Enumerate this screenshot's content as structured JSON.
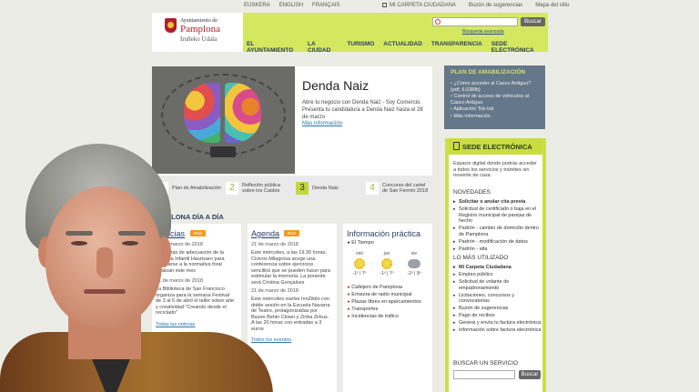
{
  "topbar": {
    "languages": [
      "EUSKERA",
      "ENGLISH",
      "FRANÇAIS"
    ],
    "links": [
      "MI CARPETA CIUDADANA",
      "Buzón de sugerencias",
      "Mapa del sitio"
    ]
  },
  "header": {
    "logo": {
      "line1": "Ayuntamiento de",
      "line2": "Pamplona",
      "line3": "Iruñeko Udala"
    },
    "search_placeholder": "",
    "search_button": "Buscar",
    "advanced_search": "Búsqueda avanzada",
    "nav": [
      "EL AYUNTAMIENTO",
      "LA CIUDAD",
      "TURISMO",
      "ACTUALIDAD",
      "TRANSPARENCIA",
      "SEDE ELECTRÓNICA"
    ]
  },
  "hero": {
    "title": "Denda Naiz",
    "text": "Abre tu negocio con Denda Naiz - Soy Comercio. Presenta tu candidatura a Denda Naiz hasta el 28 de marzo",
    "more": "Más información",
    "tabs": [
      {
        "num": "1",
        "label": "Plan de Amabilización"
      },
      {
        "num": "2",
        "label": "Reflexión pública sobre los Caídos"
      },
      {
        "num": "3",
        "label": "Denda Naiz"
      },
      {
        "num": "4",
        "label": "Concurso del cartel de San Fermín 2018"
      }
    ]
  },
  "amabilizacion": {
    "title": "PLAN DE AMABILIZACIÓN",
    "items": [
      "¿Cómo acceder al Casco Antiguo? (pdf, 6,63Mb)",
      "Control de acceso de vehículos al Casco Antiguo",
      "Aplicación Tok-tok",
      "Más información"
    ]
  },
  "sede": {
    "title": "SEDE ELECTRÓNICA",
    "description": "Espacio digital donde podrás acceder a todos los servicios y trámites sin moverte de casa",
    "novedades_title": "NOVEDADES",
    "novedades": [
      "Solicitar o anular cita previa",
      "Solicitud de certificado o baja en el Registro municipal de parejas de hecho",
      "Padrón - cambio de domicilio dentro de Pamplona",
      "Padrón - modificación de datos",
      "Padrón - alta"
    ],
    "mas_title": "LO MÁS UTILIZADO",
    "mas": [
      "Mi Carpeta Ciudadana",
      "Empleo público",
      "Solicitud de volante de empadronamiento",
      "Licitaciones, concursos y convocatorias",
      "Buzón de sugerencias",
      "Pago de recibos",
      "Genera y envía tu factura electrónica",
      "Información sobre factura electrónica"
    ],
    "buscar_title": "BUSCAR UN SERVICIO",
    "buscar_button": "Buscar"
  },
  "dia": {
    "title": "PAMPLONA DÍA A DÍA",
    "noticias": {
      "title": "Noticias",
      "rss": "RSS",
      "items": [
        {
          "date": "21 de marzo de 2018",
          "text": "Las obras de adecuación de la Escuela Infantil Haurtzaro para adaptarse a la normativa foral finalizan este mes"
        },
        {
          "date": "21 de marzo de 2018",
          "text": "La Biblioteca de San Francisco organiza para la semana Festival de 3 al 6 de abril el taller sobre arte y creatividad \"Creando desde el reciclado\""
        }
      ],
      "all": "Todas las noticias"
    },
    "agenda": {
      "title": "Agenda",
      "rss": "RSS",
      "items": [
        {
          "date": "21 de marzo de 2018",
          "text": "Este miércoles, a las 19.30 horas, Civivox Milagrosa acoge una conferencia sobre ejercicios sencillos que se pueden hacer para estimular la memoria. La ponente será Cristina Gonçalves"
        },
        {
          "date": "21 de marzo de 2018",
          "text": "Este miércoles vuelve InnZikilo con doble sesión en la Escuela Navarra de Teatro, protagonizadas por Bazen Behin Clown y Zirika Zirkus. A las 20 horas con entradas a 3 euros"
        }
      ],
      "all": "Todos los eventos"
    },
    "info": {
      "title": "Información práctica",
      "tiempo": "El Tiempo",
      "weather": [
        {
          "day": "mié",
          "temps": "-1º | 7º",
          "icon": "sun-icon"
        },
        {
          "day": "jue",
          "temps": "-1º | 7º",
          "icon": "sun-icon"
        },
        {
          "day": "vie",
          "temps": "-2º | 9º",
          "icon": "cloud-icon"
        }
      ],
      "items": [
        "Callejero de Pamplona",
        "Emisora de radio municipal",
        "Plazas libres en aparcamientos",
        "Transportes",
        "Incidencias de tráfico"
      ]
    }
  }
}
